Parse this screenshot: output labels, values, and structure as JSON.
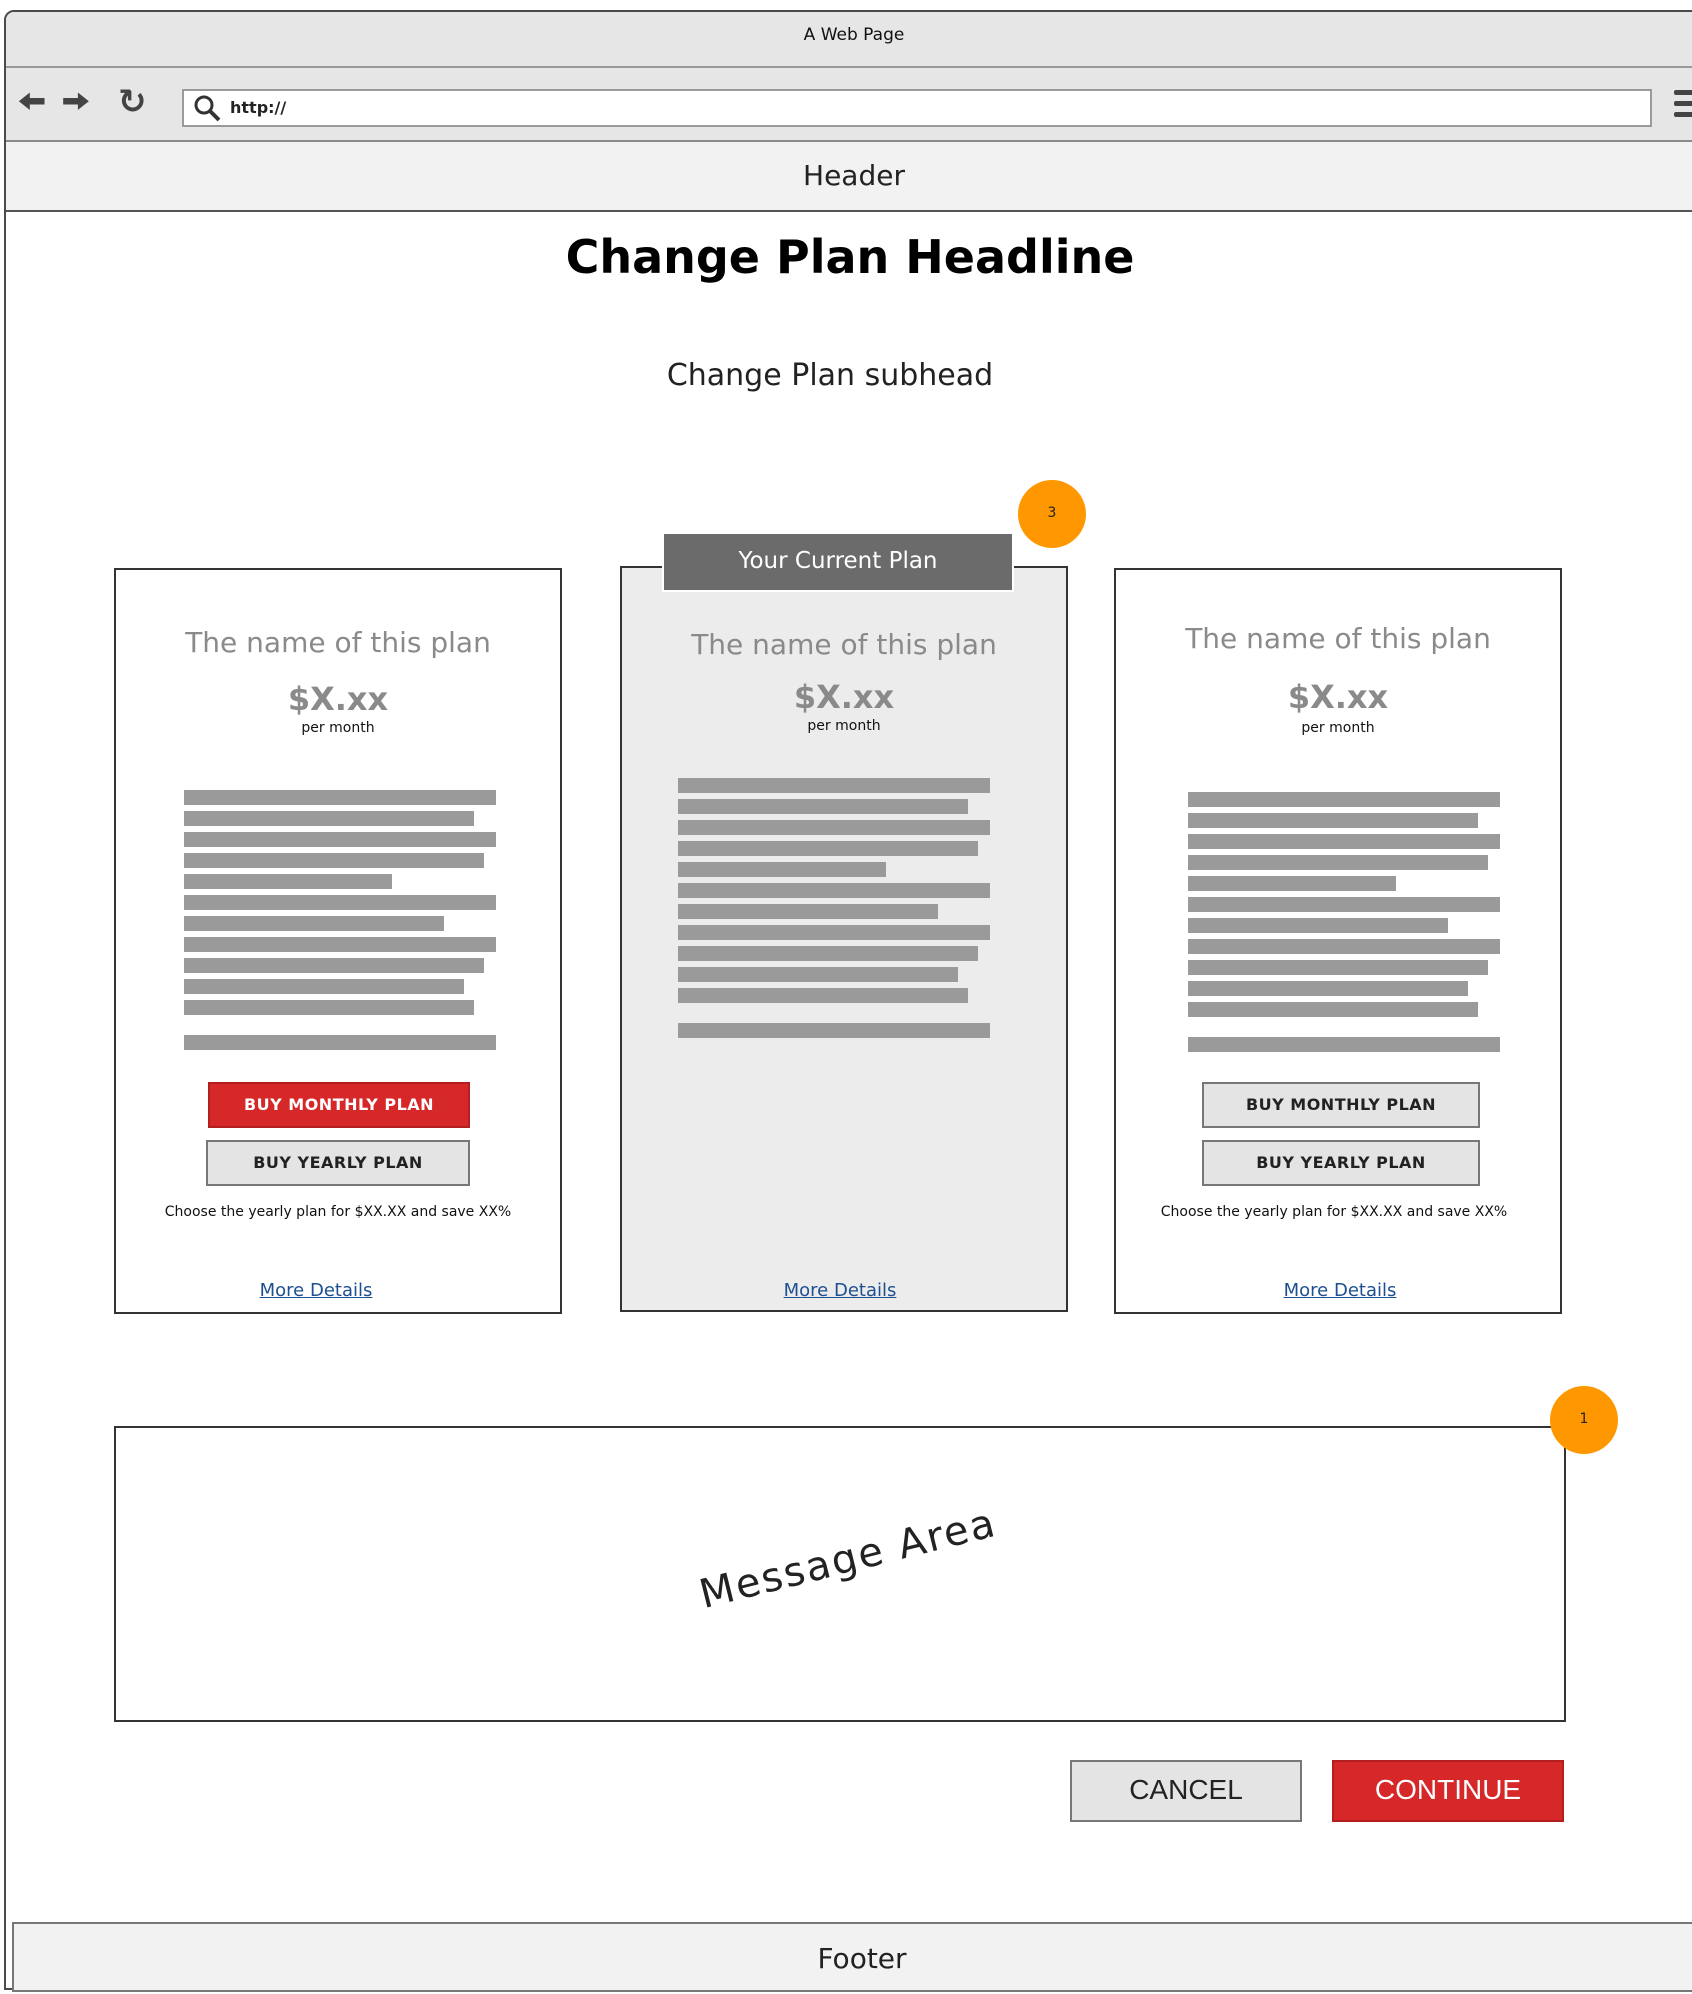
{
  "window": {
    "title": "A Web Page"
  },
  "navbar": {
    "url": "http://"
  },
  "header": {
    "label": "Header"
  },
  "page": {
    "headline": "Change Plan Headline",
    "subhead": "Change Plan subhead"
  },
  "current_plan_tab": "Your Current Plan",
  "plans": [
    {
      "name": "The name of this plan",
      "price": "$X.xx",
      "period": "per month",
      "monthly_button": "BUY MONTHLY PLAN",
      "yearly_button": "BUY YEARLY PLAN",
      "save_note": "Choose the yearly plan for $XX.XX and save XX%",
      "details_link": "More Details"
    },
    {
      "name": "The name of this plan",
      "price": "$X.xx",
      "period": "per month",
      "details_link": "More Details"
    },
    {
      "name": "The name of this plan",
      "price": "$X.xx",
      "period": "per month",
      "monthly_button": "BUY MONTHLY PLAN",
      "yearly_button": "BUY YEARLY PLAN",
      "save_note": "Choose the yearly plan for $XX.XX and save XX%",
      "details_link": "More Details"
    }
  ],
  "badges": {
    "current_plan": "3",
    "message_area": "1"
  },
  "message_area": {
    "label": "Message Area"
  },
  "actions": {
    "cancel": "CANCEL",
    "continue": "CONTINUE"
  },
  "footer": {
    "label": "Footer"
  },
  "colors": {
    "accent_red": "#d62828",
    "badge_orange": "#ff9800",
    "link_blue": "#1d4f91"
  },
  "icons": [
    "back-arrow-icon",
    "forward-arrow-icon",
    "reload-icon",
    "search-icon",
    "hamburger-menu-icon"
  ]
}
